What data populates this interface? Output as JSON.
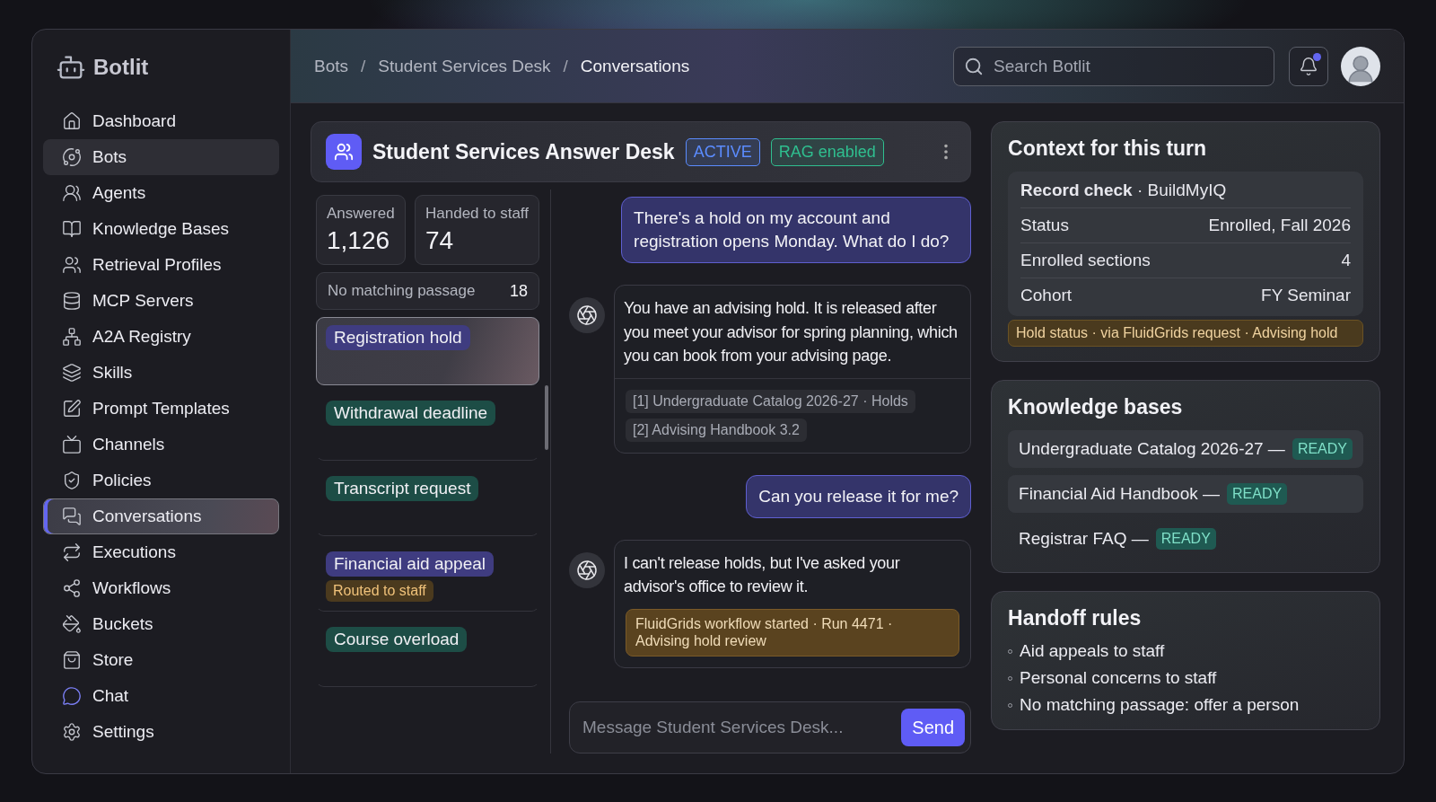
{
  "brand": "Botlit",
  "nav": [
    {
      "label": "Dashboard",
      "selected": false,
      "hovered": false
    },
    {
      "label": "Bots",
      "selected": false,
      "hovered": true
    },
    {
      "label": "Agents",
      "selected": false,
      "hovered": false
    },
    {
      "label": "Knowledge Bases",
      "selected": false,
      "hovered": false
    },
    {
      "label": "Retrieval Profiles",
      "selected": false,
      "hovered": false
    },
    {
      "label": "MCP Servers",
      "selected": false,
      "hovered": false
    },
    {
      "label": "A2A Registry",
      "selected": false,
      "hovered": false
    },
    {
      "label": "Skills",
      "selected": false,
      "hovered": false
    },
    {
      "label": "Prompt Templates",
      "selected": false,
      "hovered": false
    },
    {
      "label": "Channels",
      "selected": false,
      "hovered": false
    },
    {
      "label": "Policies",
      "selected": false,
      "hovered": false
    },
    {
      "label": "Conversations",
      "selected": true,
      "hovered": false
    },
    {
      "label": "Executions",
      "selected": false,
      "hovered": false
    },
    {
      "label": "Workflows",
      "selected": false,
      "hovered": false
    },
    {
      "label": "Buckets",
      "selected": false,
      "hovered": false
    },
    {
      "label": "Store",
      "selected": false,
      "hovered": false
    },
    {
      "label": "Chat",
      "selected": false,
      "hovered": false
    },
    {
      "label": "Settings",
      "selected": false,
      "hovered": false
    }
  ],
  "breadcrumbs": [
    "Bots",
    "Student Services Desk",
    "Conversations"
  ],
  "breadcrumb_separator": "/",
  "search": {
    "placeholder": "Search Botlit"
  },
  "notifications": {
    "unread": true
  },
  "bot": {
    "name": "Student Services Answer Desk",
    "badges": [
      {
        "label": "ACTIVE",
        "color": "#5b8cff"
      },
      {
        "label": "RAG enabled",
        "color": "#2fbf8f"
      }
    ]
  },
  "stats": [
    {
      "label": "Answered",
      "value": "1,126"
    },
    {
      "label": "Handed to staff",
      "value": "74"
    }
  ],
  "unmatched": {
    "label": "No matching passage",
    "value": "18"
  },
  "topics": [
    {
      "label": "Registration hold",
      "color": "#3f3c80",
      "selected": true
    },
    {
      "label": "Withdrawal deadline",
      "color": "#1d4d46",
      "selected": false
    },
    {
      "label": "Transcript request",
      "color": "#1d4d46",
      "selected": false
    },
    {
      "label": "Financial aid appeal",
      "color": "#3f3c80",
      "selected": false,
      "tag": "Routed to staff"
    },
    {
      "label": "Course overload",
      "color": "#1d4d46",
      "selected": false
    }
  ],
  "messages": [
    {
      "kind": "user",
      "text": "There's a hold on my account and registration opens Monday. What do I do?"
    },
    {
      "kind": "bot",
      "text": "You have an advising hold. It is released after you meet your advisor for spring planning, which you can book from your advising page.",
      "sources": [
        "[1] Undergraduate Catalog 2026-27 · Holds",
        "[2] Advising Handbook 3.2"
      ]
    },
    {
      "kind": "user",
      "text": "Can you release it for me?"
    },
    {
      "kind": "bot",
      "text": "I can't release holds, but I've asked your advisor's office to review it.",
      "workflow": "FluidGrids workflow started · Run 4471 · Advising hold review"
    }
  ],
  "composer": {
    "placeholder": "Message Student Services Desk...",
    "send": "Send"
  },
  "context": {
    "title": "Context for this turn",
    "record_title": "Record check",
    "record_source": "· BuildMyIQ",
    "rows": [
      {
        "label": "Status",
        "value": "Enrolled, Fall 2026"
      },
      {
        "label": "Enrolled sections",
        "value": "4"
      },
      {
        "label": "Cohort",
        "value": "FY Seminar"
      }
    ],
    "hold": "Hold status · via FluidGrids request · Advising hold"
  },
  "knowledge_bases": {
    "title": "Knowledge bases",
    "items": [
      {
        "name": "Undergraduate Catalog 2026-27 —",
        "status": "READY",
        "highlighted": true
      },
      {
        "name": "Financial Aid Handbook —",
        "status": "READY",
        "highlighted": true
      },
      {
        "name": "Registrar FAQ —",
        "status": "READY",
        "highlighted": false
      }
    ]
  },
  "handoff": {
    "title": "Handoff rules",
    "rules": [
      "Aid appeals to staff",
      "Personal concerns to staff",
      "No matching passage: offer a person"
    ]
  }
}
